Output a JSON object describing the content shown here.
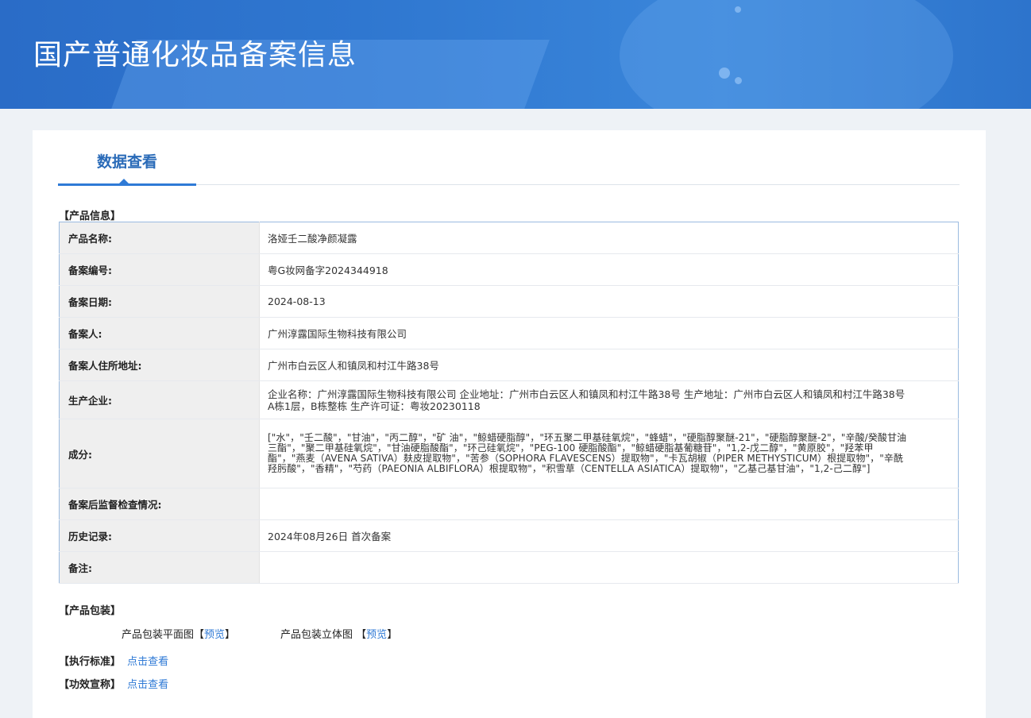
{
  "header": {
    "title": "国产普通化妆品备案信息"
  },
  "tabs": [
    {
      "label": "数据查看",
      "active": true
    }
  ],
  "product_info": {
    "section_label": "【产品信息】",
    "rows": [
      {
        "label": "产品名称:",
        "value": "洛娅壬二酸净颜凝露"
      },
      {
        "label": "备案编号:",
        "value": "粤G妆网备字2024344918"
      },
      {
        "label": "备案日期:",
        "value": "2024-08-13"
      },
      {
        "label": "备案人:",
        "value": "广州淳露国际生物科技有限公司"
      },
      {
        "label": "备案人住所地址:",
        "value": "广州市白云区人和镇凤和村江牛路38号"
      },
      {
        "label": "生产企业:",
        "value": "企业名称：广州淳露国际生物科技有限公司 企业地址：广州市白云区人和镇凤和村江牛路38号 生产地址：广州市白云区人和镇凤和村江牛路38号A栋1层，B栋整栋 生产许可证：粤妆20230118"
      },
      {
        "label": "成分:",
        "value": "[\"水\"，\"壬二酸\"，\"甘油\"，\"丙二醇\"，\"矿 油\"，\"鲸蜡硬脂醇\"，\"环五聚二甲基硅氧烷\"，\"蜂蜡\"，\"硬脂醇聚醚-21\"，\"硬脂醇聚醚-2\"，\"辛酸/癸酸甘油三酯\"，\"聚二甲基硅氧烷\"，\"甘油硬脂酸酯\"，\"环己硅氧烷\"，\"PEG-100 硬脂酸酯\"，\"鲸蜡硬脂基葡糖苷\"，\"1,2-戊二醇\"，\"黄原胶\"，\"羟苯甲酯\"，\"燕麦（AVENA SATIVA）麸皮提取物\"，\"苦参（SOPHORA FLAVESCENS）提取物\"，\"卡瓦胡椒（PIPER METHYSTICUM）根提取物\"，\"辛酰羟肟酸\"，\"香精\"，\"芍药（PAEONIA ALBIFLORA）根提取物\"，\"积雪草（CENTELLA ASIATICA）提取物\"，\"乙基己基甘油\"，\"1,2-己二醇\"]"
      },
      {
        "label": "备案后监督检查情况:",
        "value": ""
      },
      {
        "label": "历史记录:",
        "value": "2024年08月26日 首次备案"
      },
      {
        "label": "备注:",
        "value": ""
      }
    ]
  },
  "packaging": {
    "section_label": "【产品包装】",
    "flat_label": "产品包装平面图",
    "flat_link": "预览",
    "stereo_label": "产品包装立体图",
    "stereo_link": "预览",
    "bracket_open": "【",
    "bracket_close": "】"
  },
  "standard": {
    "label": "【执行标准】",
    "link": "点击查看"
  },
  "efficacy": {
    "label": "【功效宣称】",
    "link": "点击查看"
  }
}
